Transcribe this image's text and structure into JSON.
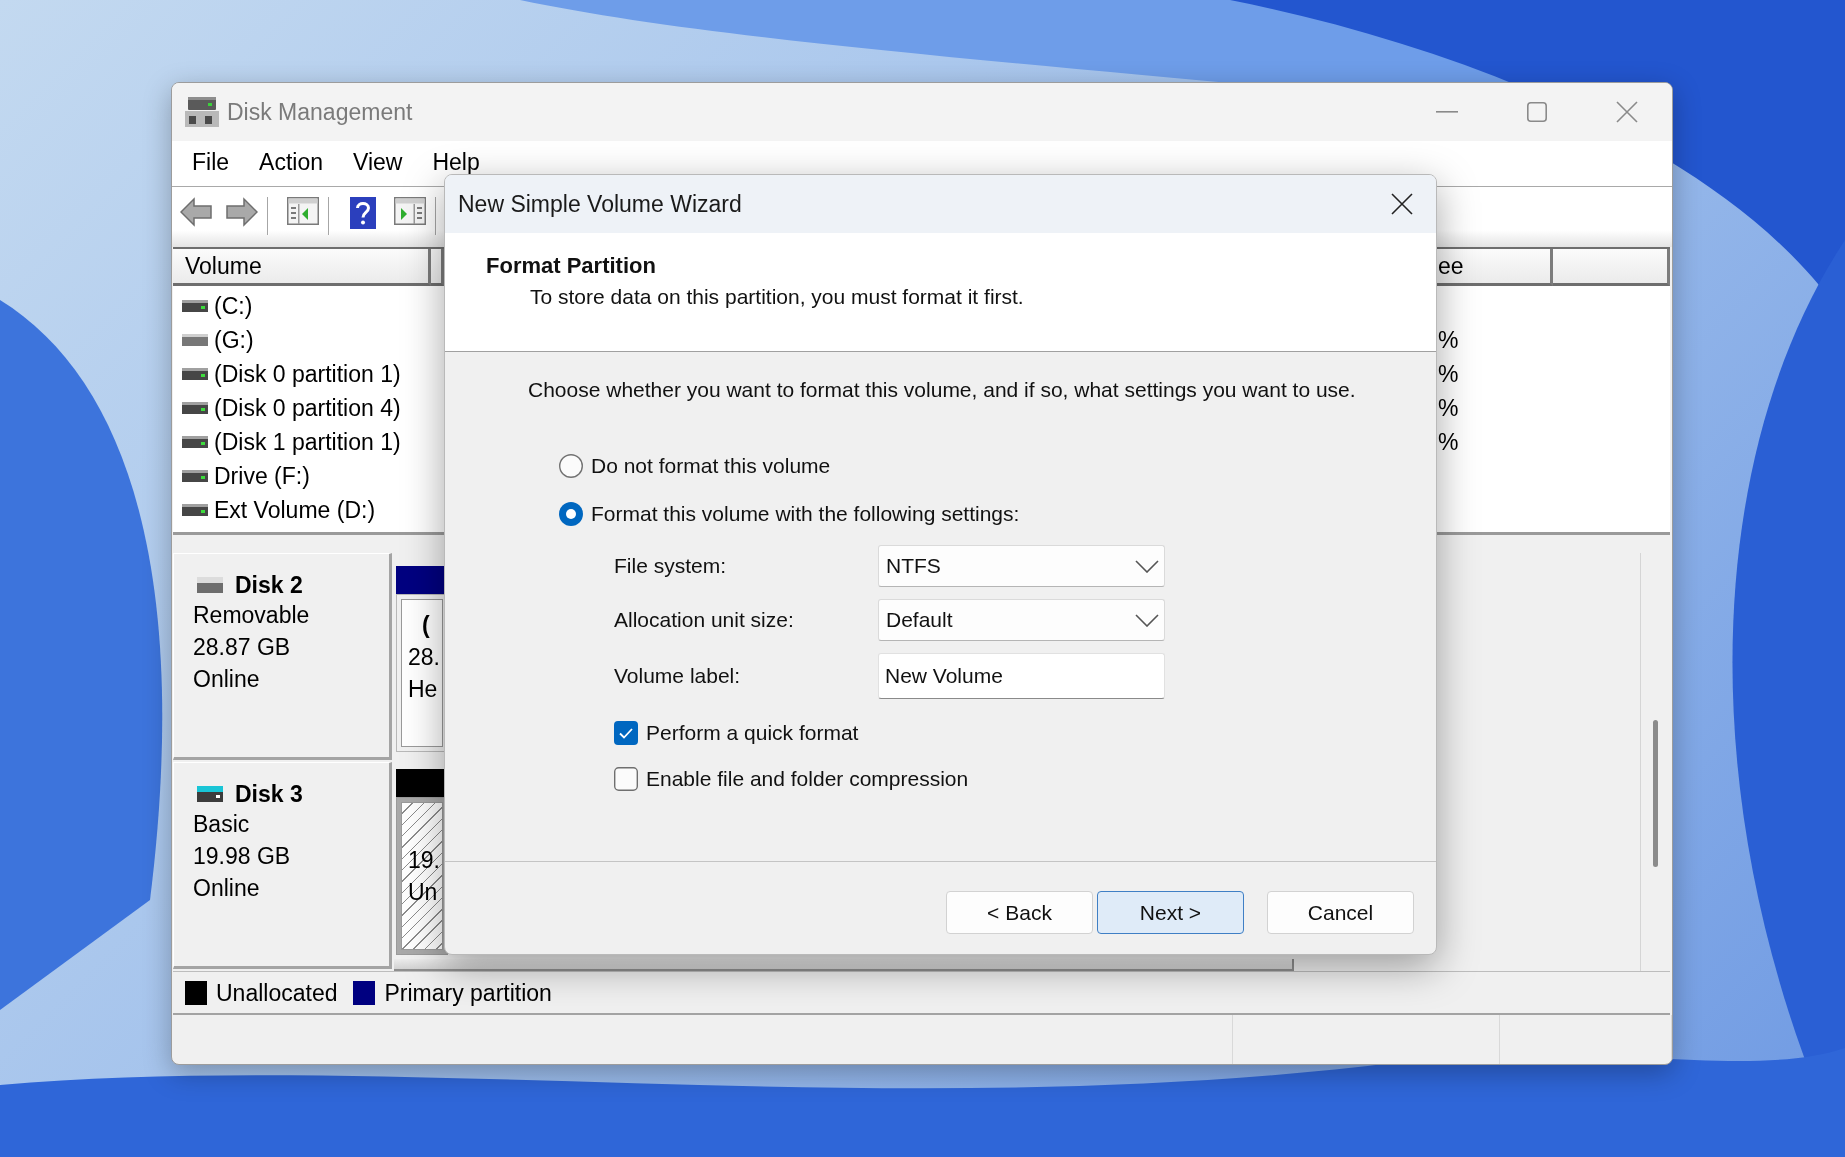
{
  "window": {
    "title": "Disk Management",
    "menu": [
      "File",
      "Action",
      "View",
      "Help"
    ]
  },
  "volume_table": {
    "columns": [
      {
        "label": "Volume"
      },
      {
        "label": "ee"
      }
    ],
    "rows": [
      {
        "kind": "fixed",
        "volume": "(C:)"
      },
      {
        "kind": "removable",
        "volume": "(G:)",
        "column_2": "%"
      },
      {
        "kind": "fixed",
        "volume": "(Disk 0 partition 1)",
        "column_2": "%"
      },
      {
        "kind": "fixed",
        "volume": "(Disk 0 partition 4)",
        "column_2": "%"
      },
      {
        "kind": "fixed",
        "volume": "(Disk 1 partition 1)",
        "column_2": "%"
      },
      {
        "kind": "fixed",
        "volume": "Drive (F:)"
      },
      {
        "kind": "fixed",
        "volume": "Ext Volume (D:)"
      }
    ]
  },
  "disks": [
    {
      "kind": "removable",
      "name": "Disk 2",
      "details": [
        "Removable",
        "28.87 GB",
        "Online"
      ],
      "partition": {
        "kind": "primary",
        "label": "(",
        "size": "28.",
        "status": "He"
      }
    },
    {
      "kind": "basic",
      "name": "Disk 3",
      "details": [
        "Basic",
        "19.98 GB",
        "Online"
      ],
      "partition": {
        "kind": "unallocated",
        "size": "19.",
        "status": "Un"
      }
    }
  ],
  "legend": [
    {
      "label": "Unallocated",
      "color": "#000000"
    },
    {
      "label": "Primary partition",
      "color": "#000080"
    }
  ],
  "dialog": {
    "title": "New Simple Volume Wizard",
    "heading": "Format Partition",
    "subheading": "To store data on this partition, you must format it first.",
    "instruction": "Choose whether you want to format this volume, and if so, what settings you want to use.",
    "options": [
      {
        "label": "Do not format this volume",
        "selected": false
      },
      {
        "label": "Format this volume with the following settings:",
        "selected": true
      }
    ],
    "settings": [
      {
        "kind": "dropdown",
        "label": "File system:",
        "value": "NTFS"
      },
      {
        "kind": "dropdown",
        "label": "Allocation unit size:",
        "value": "Default"
      },
      {
        "kind": "text",
        "label": "Volume label:",
        "value": "New Volume"
      }
    ],
    "checkboxes": [
      {
        "label": "Perform a quick format",
        "checked": true
      },
      {
        "label": "Enable file and folder compression",
        "checked": false
      }
    ],
    "buttons": [
      {
        "label": "< Back",
        "default": false
      },
      {
        "label": "Next >",
        "default": true
      },
      {
        "label": "Cancel",
        "default": false
      }
    ]
  }
}
